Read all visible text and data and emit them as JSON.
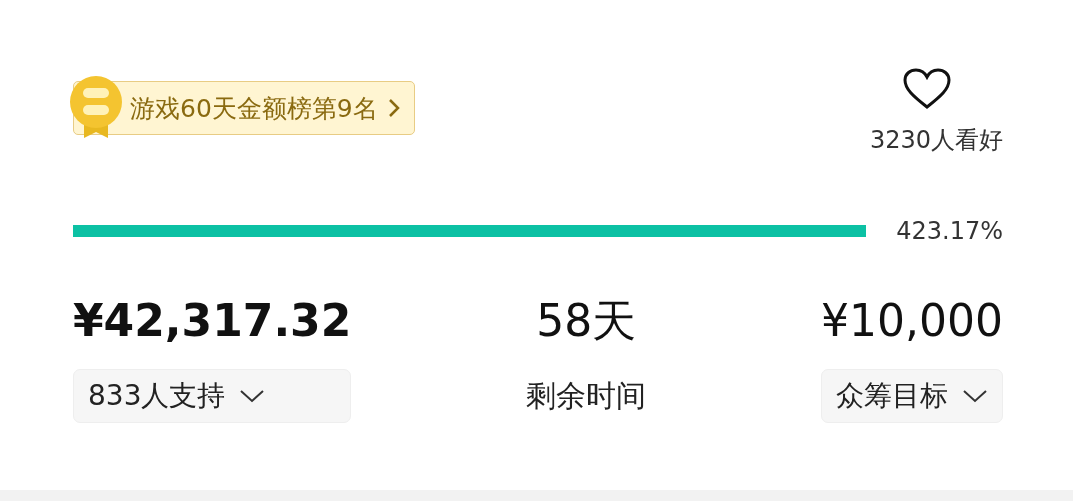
{
  "ranking_badge": {
    "label": "游戏60天金额榜第9名"
  },
  "favorite": {
    "count": "3230人看好"
  },
  "progress": {
    "level": 1,
    "reading": "423.17%"
  },
  "stats": [
    {
      "kind": "dropdown",
      "value": "¥42,317.32",
      "label": "833人支持"
    },
    {
      "kind": "plain",
      "value": "58天",
      "label": "剩余时间"
    },
    {
      "kind": "dropdown",
      "value": "¥10,000",
      "label": "众筹目标"
    }
  ]
}
